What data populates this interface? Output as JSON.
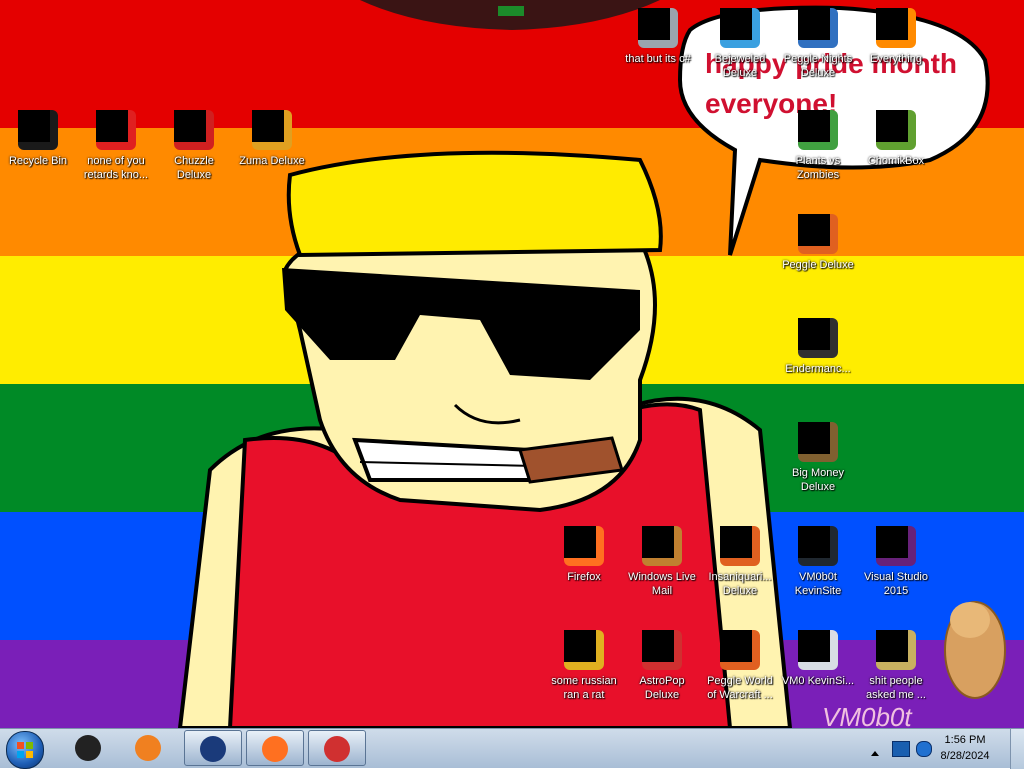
{
  "wallpaper": {
    "stripe_colors": [
      "#e40000",
      "#ff8a00",
      "#ffed00",
      "#008a26",
      "#0050ff",
      "#7a1fb8"
    ],
    "speech_bubble_text_line1": "happy pride month",
    "speech_bubble_text_line2": "everyone!",
    "watermark_text": "VM0b0t"
  },
  "desktop_icons": [
    {
      "label": "Recycle Bin",
      "icon": "recycle-bin-icon",
      "color": "#1a1a1a"
    },
    {
      "label": "none of you retards kno...",
      "icon": "app-icon",
      "color": "#e02020"
    },
    {
      "label": "Chuzzle Deluxe",
      "icon": "chuzzle-icon",
      "color": "#d02020"
    },
    {
      "label": "Zuma Deluxe",
      "icon": "zuma-icon",
      "color": "#e0a020"
    },
    {
      "label": "that but its c#",
      "icon": "window-icon",
      "color": "#9aa4ae"
    },
    {
      "label": "Bejeweled Deluxe",
      "icon": "bejeweled-icon",
      "color": "#3aa0e0"
    },
    {
      "label": "Peggle Nights Deluxe",
      "icon": "peggle-nights-icon",
      "color": "#3070c0"
    },
    {
      "label": "Everything",
      "icon": "everything-icon",
      "color": "#ff8a00"
    },
    {
      "label": "Plants vs Zombies",
      "icon": "plants-vs-zombies-icon",
      "color": "#40a040"
    },
    {
      "label": "ChomikBox",
      "icon": "chomikbox-icon",
      "color": "#60a030"
    },
    {
      "label": "Peggle Deluxe",
      "icon": "peggle-icon",
      "color": "#e06020"
    },
    {
      "label": "Endermanc...",
      "icon": "terminal-icon",
      "color": "#303030"
    },
    {
      "label": "Big Money Deluxe",
      "icon": "big-money-icon",
      "color": "#806030"
    },
    {
      "label": "Firefox",
      "icon": "firefox-icon",
      "color": "#ff7020"
    },
    {
      "label": "Windows Live Mail",
      "icon": "mail-icon",
      "color": "#c08030"
    },
    {
      "label": "Insaniquari... Deluxe",
      "icon": "insaniquarium-icon",
      "color": "#e06020"
    },
    {
      "label": "VM0b0t KevinSite",
      "icon": "website-icon",
      "color": "#202830"
    },
    {
      "label": "Visual Studio 2015",
      "icon": "visual-studio-icon",
      "color": "#68217a"
    },
    {
      "label": "some russian ran a rat",
      "icon": "file-icon",
      "color": "#e0b020"
    },
    {
      "label": "AstroPop Deluxe",
      "icon": "astropop-icon",
      "color": "#d03030"
    },
    {
      "label": "Peggle World of Warcraft ...",
      "icon": "peggle-wow-icon",
      "color": "#e06020"
    },
    {
      "label": "VM0 KevinSi...",
      "icon": "document-icon",
      "color": "#d8dde4"
    },
    {
      "label": "shit people asked me ...",
      "icon": "folder-icon",
      "color": "#c8b060"
    }
  ],
  "taskbar": {
    "start_icon": "windows-orb-icon",
    "pinned": [
      {
        "icon": "console-icon",
        "color": "#222222"
      },
      {
        "icon": "media-player-icon",
        "color": "#f08020"
      },
      {
        "icon": "vm-icon",
        "color": "#1a3a7a"
      },
      {
        "icon": "firefox-icon",
        "color": "#ff7020"
      },
      {
        "icon": "paint-icon",
        "color": "#d03030"
      }
    ],
    "clock_time": "1:56 PM",
    "clock_date": "8/28/2024"
  }
}
